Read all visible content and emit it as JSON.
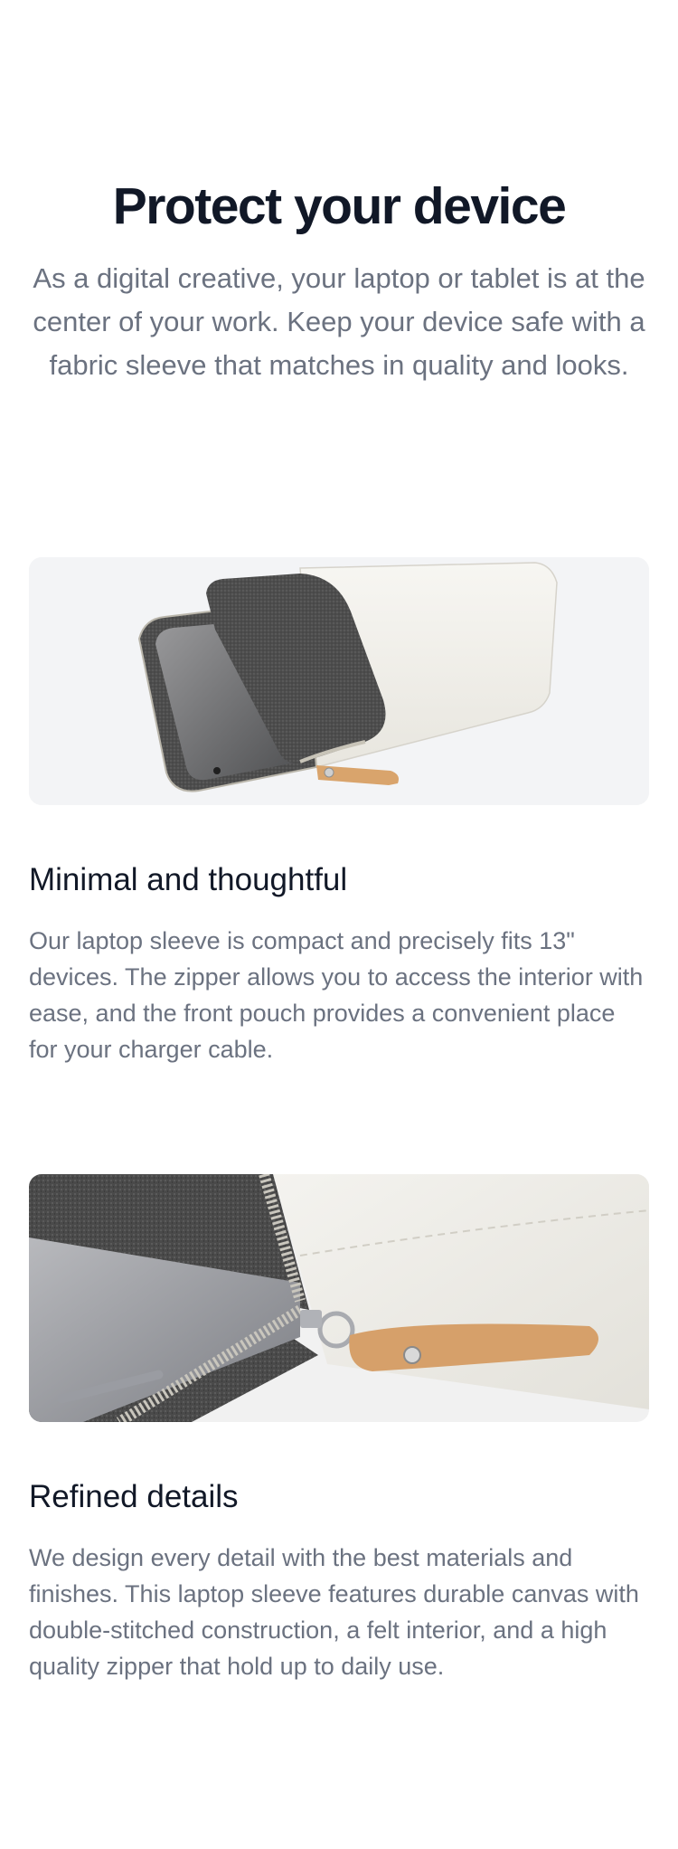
{
  "header": {
    "title": "Protect your device",
    "description": "As a digital creative, your laptop or tablet is at the center of your work. Keep your device safe with a fabric sleeve that matches in quality and looks."
  },
  "features": [
    {
      "image_alt": "Laptop sleeve with felt pouch and tablet",
      "title": "Minimal and thoughtful",
      "description": "Our laptop sleeve is compact and precisely fits 13\" devices. The zipper allows you to access the interior with ease, and the front pouch provides a convenient place for your charger cable."
    },
    {
      "image_alt": "Close-up of zipper and leather pull tab",
      "title": "Refined details",
      "description": "We design every detail with the best materials and finishes. This laptop sleeve features durable canvas with double-stitched construction, a felt interior, and a high quality zipper that hold up to daily use."
    }
  ],
  "colors": {
    "heading": "#111827",
    "body_text": "#6b7280",
    "image_background": "#f3f4f6",
    "canvas": "#f1f0ec",
    "felt": "#4b4b4b",
    "leather": "#d9a46c"
  }
}
